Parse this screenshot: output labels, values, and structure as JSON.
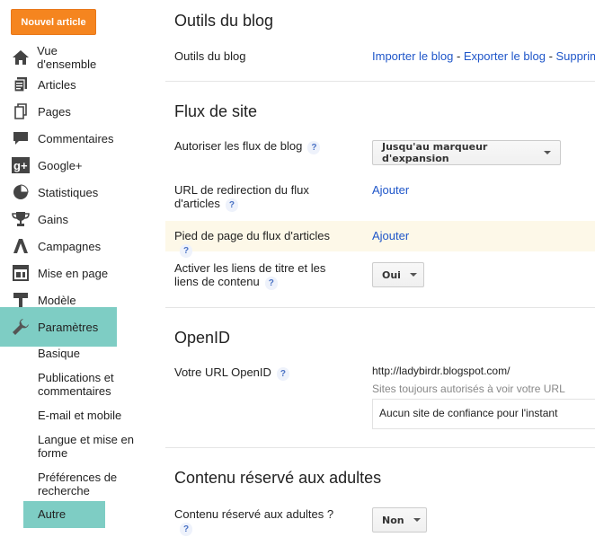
{
  "sidebar": {
    "new_post": "Nouvel article",
    "items": [
      {
        "label": "Vue d'ensemble",
        "icon": "home-icon"
      },
      {
        "label": "Articles",
        "icon": "posts-icon"
      },
      {
        "label": "Pages",
        "icon": "pages-icon"
      },
      {
        "label": "Commentaires",
        "icon": "comments-icon"
      },
      {
        "label": "Google+",
        "icon": "google-plus-icon"
      },
      {
        "label": "Statistiques",
        "icon": "stats-icon"
      },
      {
        "label": "Gains",
        "icon": "trophy-icon"
      },
      {
        "label": "Campagnes",
        "icon": "campaigns-icon"
      },
      {
        "label": "Mise en page",
        "icon": "layout-icon"
      },
      {
        "label": "Modèle",
        "icon": "template-icon"
      },
      {
        "label": "Paramètres",
        "icon": "wrench-icon"
      }
    ],
    "sub_items": [
      "Basique",
      "Publications et commentaires",
      "E-mail et mobile",
      "Langue et mise en forme",
      "Préférences de recherche",
      "Autre"
    ]
  },
  "sections": {
    "tools": {
      "title": "Outils du blog",
      "row_label": "Outils du blog",
      "link_import": "Importer le blog",
      "sep1": " - ",
      "link_export": "Exporter le blog",
      "sep2": " - ",
      "link_delete": "Supprim"
    },
    "feed": {
      "title": "Flux de site",
      "allow_label": "Autoriser les flux de blog",
      "allow_value": "Jusqu'au marqueur d'expansion",
      "redirect_label": "URL de redirection du flux d'articles",
      "redirect_action": "Ajouter",
      "footer_label": "Pied de page du flux d'articles",
      "footer_action": "Ajouter",
      "links_label": "Activer les liens de titre et les liens de contenu",
      "links_value": "Oui"
    },
    "openid": {
      "title": "OpenID",
      "url_label": "Votre URL OpenID",
      "url_value": "http://ladybirdr.blogspot.com/",
      "trusted_hint": "Sites toujours autorisés à voir votre URL",
      "trusted_empty": "Aucun site de confiance pour l'instant"
    },
    "adult": {
      "title": "Contenu réservé aux adultes",
      "row_label": "Contenu réservé aux adultes ?",
      "value": "Non"
    }
  },
  "help_glyph": "?",
  "colors": {
    "accent": "#f5851f",
    "active": "#7ecdc4",
    "link": "#1f56c9"
  }
}
